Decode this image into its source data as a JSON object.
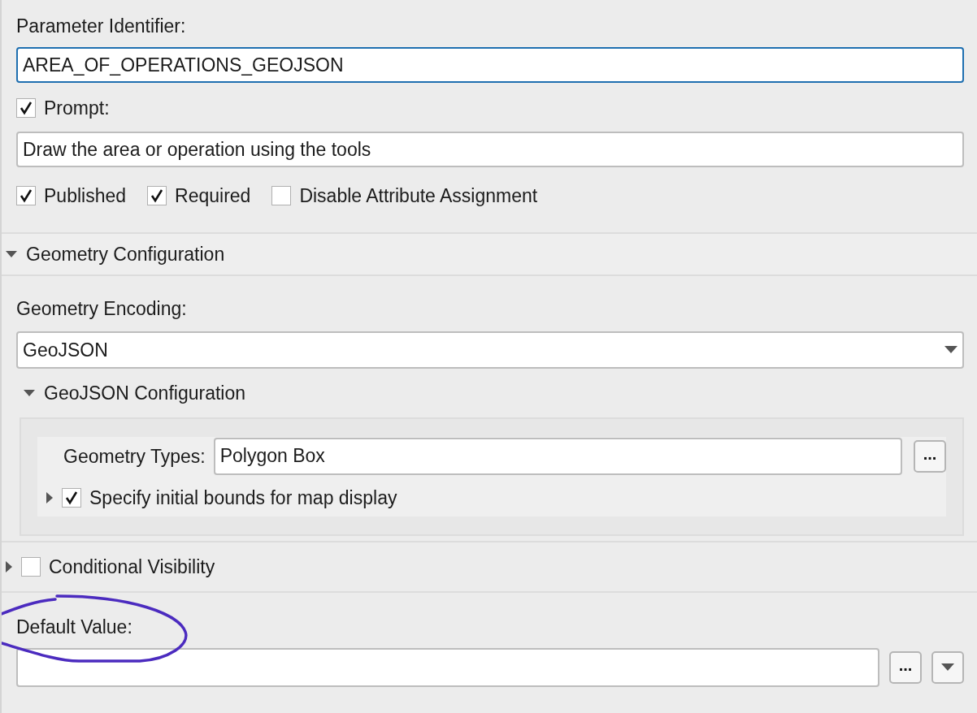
{
  "parameter_identifier": {
    "label": "Parameter Identifier:",
    "value": "AREA_OF_OPERATIONS_GEOJSON",
    "focused": true
  },
  "prompt": {
    "label": "Prompt:",
    "checked": true,
    "value": "Draw the area or operation using the tools"
  },
  "options": [
    {
      "label": "Published",
      "checked": true
    },
    {
      "label": "Required",
      "checked": true
    },
    {
      "label": "Disable Attribute Assignment",
      "checked": false
    }
  ],
  "geometry_configuration": {
    "title": "Geometry Configuration",
    "expanded": true,
    "encoding_label": "Geometry Encoding:",
    "encoding_value": "GeoJSON",
    "geojson_configuration": {
      "title": "GeoJSON Configuration",
      "expanded": true,
      "geometry_types_label": "Geometry Types:",
      "geometry_types_value": "Polygon Box",
      "browse_button": "...",
      "initial_bounds": {
        "label": "Specify initial bounds for map display",
        "checked": true,
        "expanded": false
      }
    }
  },
  "conditional_visibility": {
    "label": "Conditional Visibility",
    "checked": false,
    "expanded": false
  },
  "default_value": {
    "label": "Default Value:",
    "browse_button": "..."
  }
}
